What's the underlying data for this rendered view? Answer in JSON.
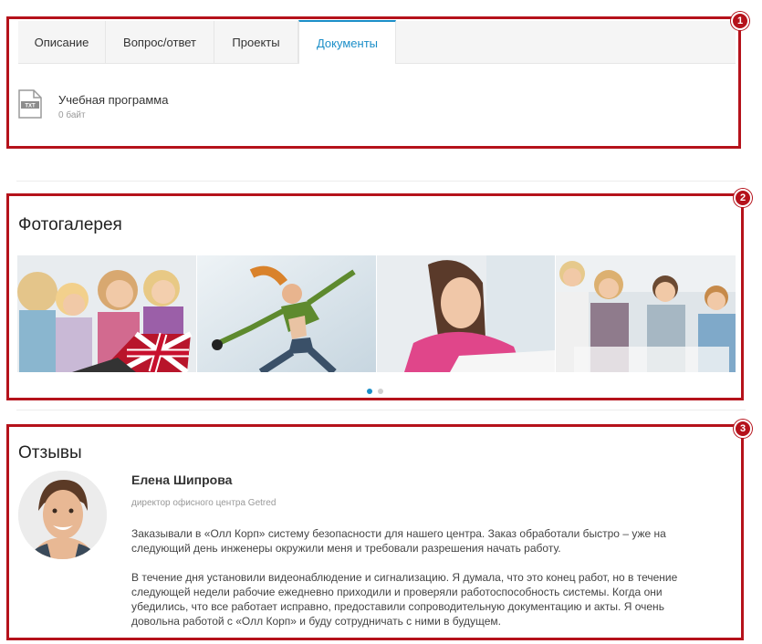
{
  "tabs": [
    {
      "label": "Описание",
      "active": false
    },
    {
      "label": "Вопрос/ответ",
      "active": false
    },
    {
      "label": "Проекты",
      "active": false
    },
    {
      "label": "Документы",
      "active": true
    }
  ],
  "document": {
    "icon": "txt-file-icon",
    "icon_text": "TXT",
    "title": "Учебная программа",
    "size": "0 байт"
  },
  "gallery": {
    "title": "Фотогалерея",
    "photos": [
      "children-with-laptop-photo",
      "dancer-photo",
      "student-writing-photo",
      "students-group-photo"
    ],
    "pages": 2,
    "active_page": 1
  },
  "reviews": {
    "title": "Отзывы",
    "items": [
      {
        "name": "Елена Шипрова",
        "role": "директор офисного центра Getred",
        "paragraphs": [
          "Заказывали в «Олл Корп» систему безопасности для нашего центра. Заказ обработали быстро – уже на следующий день инженеры окружили меня и требовали разрешения начать работу.",
          "В течение дня установили видеонаблюдение и сигнализацию. Я думала, что это конец работ, но в течение следующей недели рабочие ежедневно приходили и проверяли работоспособность системы. Когда они убедились, что все работает исправно, предоставили сопроводительную документацию и акты. Я очень довольна работой с «Олл Корп» и буду сотрудничать с ними в будущем."
        ]
      }
    ]
  },
  "badges": [
    "1",
    "2",
    "3"
  ],
  "colors": {
    "accent": "#1b8ec8",
    "annotation": "#b5121b"
  }
}
